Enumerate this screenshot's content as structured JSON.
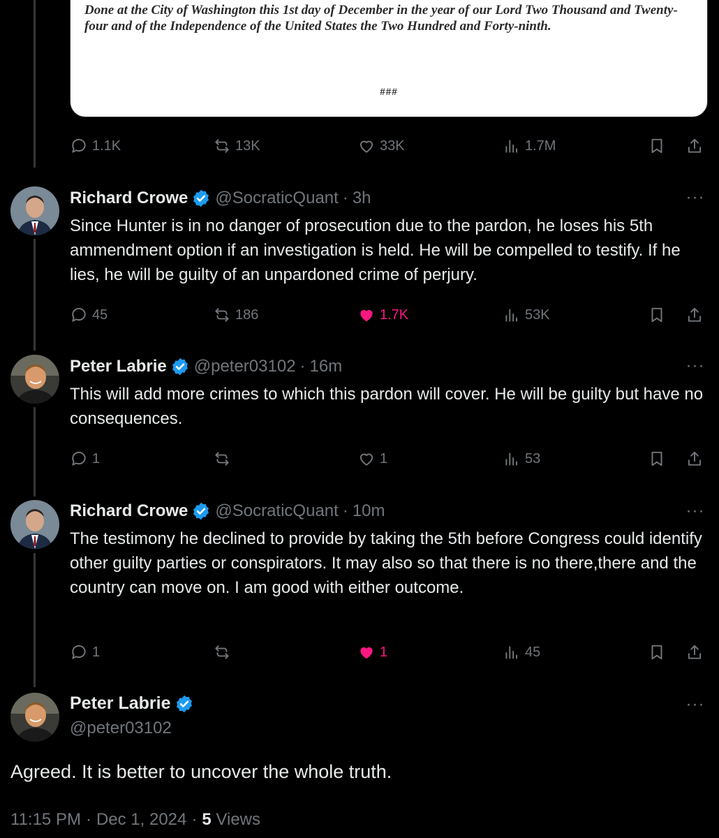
{
  "document": {
    "text": "Done at the City of Washington this 1st day of December in the year of our Lord Two Thousand and Twenty-four and of the Independence of the United States the Two Hundred and Forty-ninth.",
    "end_mark": "###"
  },
  "posts": [
    {
      "stats": {
        "replies": "1.1K",
        "reposts": "13K",
        "likes": "33K",
        "views": "1.7M",
        "liked": false
      }
    },
    {
      "name": "Richard Crowe",
      "handle": "@SocraticQuant",
      "time": "3h",
      "text": "Since Hunter is in no danger of prosecution due to the pardon, he loses his 5th ammendment option if an investigation is held.  He will be compelled to testify.  If he lies, he will be guilty of an unpardoned crime of perjury.",
      "stats": {
        "replies": "45",
        "reposts": "186",
        "likes": "1.7K",
        "views": "53K",
        "liked": true
      }
    },
    {
      "name": "Peter Labrie",
      "handle": "@peter03102",
      "time": "16m",
      "text": "This will add more crimes to which this pardon will cover. He will be guilty but have no consequences.",
      "stats": {
        "replies": "1",
        "reposts": "",
        "likes": "1",
        "views": "53",
        "liked": false
      }
    },
    {
      "name": "Richard Crowe",
      "handle": "@SocraticQuant",
      "time": "10m",
      "text": "The testimony he declined to provide by taking the 5th before Congress could identify other guilty parties or conspirators.  It may also so that there is no there,there and the country can move on.  I am good with either outcome.",
      "stats": {
        "replies": "1",
        "reposts": "",
        "likes": "1",
        "views": "45",
        "liked": true
      }
    }
  ],
  "focus": {
    "name": "Peter Labrie",
    "handle": "@peter03102",
    "text": "Agreed. It is better to uncover the whole truth.",
    "time": "11:15 PM",
    "date": "Dec 1, 2024",
    "views_count": "5",
    "views_label": "Views"
  },
  "colors": {
    "background": "#000000",
    "text": "#e7e9ea",
    "muted": "#71767b",
    "like_pink": "#f91880",
    "verified_blue": "#1d9bf0"
  },
  "icons": [
    "reply-icon",
    "repost-icon",
    "like-icon",
    "views-icon",
    "bookmark-icon",
    "share-icon",
    "verified-icon",
    "more-icon"
  ]
}
